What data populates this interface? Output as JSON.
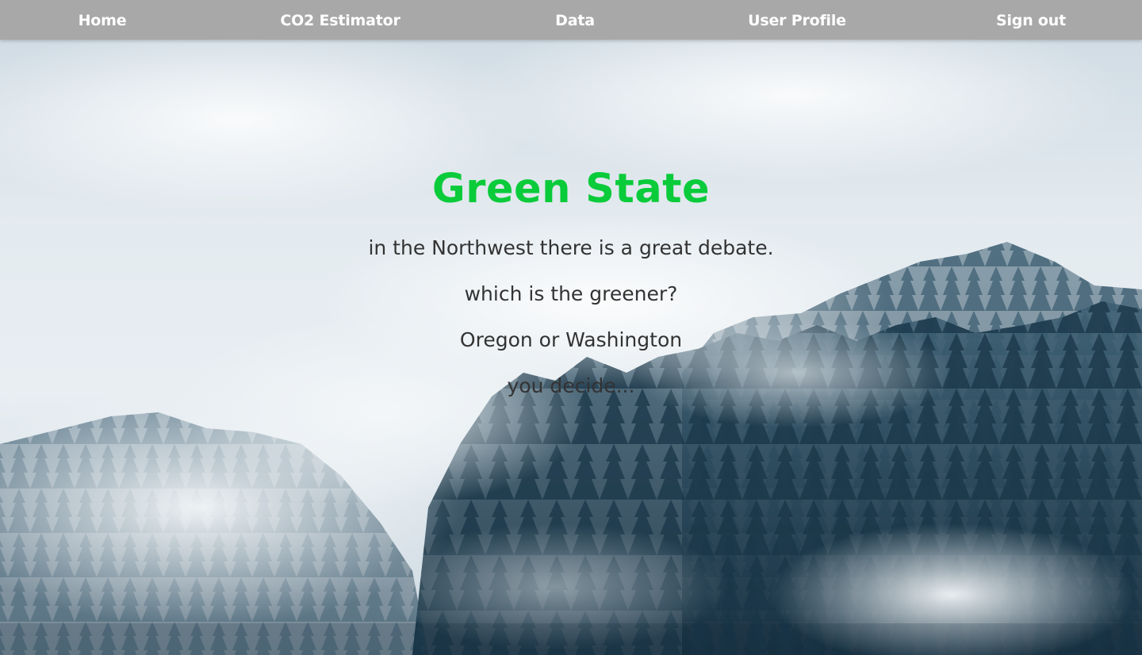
{
  "nav": {
    "items": [
      {
        "label": "Home"
      },
      {
        "label": "CO2 Estimator"
      },
      {
        "label": "Data"
      },
      {
        "label": "User Profile"
      },
      {
        "label": "Sign out"
      }
    ]
  },
  "hero": {
    "title": "Green State",
    "lines": [
      "in the Northwest there is a great debate.",
      "which is the greener?",
      "Oregon or Washington",
      "you decide..."
    ],
    "background": "misty-forest-image"
  },
  "colors": {
    "nav_bg": "#a8a8a8",
    "nav_text": "#ffffff",
    "title": "#0acb3a",
    "body_text": "#333333"
  }
}
